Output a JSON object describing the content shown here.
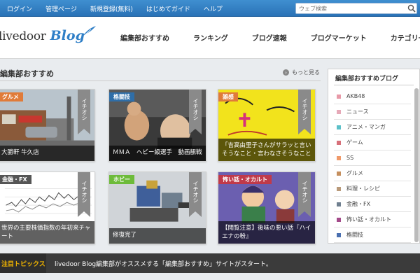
{
  "topbar": {
    "links": [
      "ログイン",
      "管理ページ",
      "新規登録(無料)",
      "はじめてガイド",
      "ヘルプ"
    ],
    "search_placeholder": "ウェブ検索"
  },
  "header": {
    "logo_text": "livedoor",
    "logo_blog": "Blog",
    "nav": [
      "編集部おすすめ",
      "ランキング",
      "ブログ速報",
      "ブログマーケット",
      "カテゴリ一覧"
    ]
  },
  "picks": {
    "title": "編集部おすすめ",
    "more": "もっと見る",
    "ribbon": "イチオシ",
    "cards": [
      {
        "tag": "グルメ",
        "tag_color": "#e07b39",
        "caption": "大勝軒 牛久店"
      },
      {
        "tag": "格闘技",
        "tag_color": "#2f6ea8",
        "caption": "ＭＭＡ　ヘビー級選手　動画観戦"
      },
      {
        "tag": "雑感",
        "tag_color": "#e07b39",
        "caption": "「吉高由里子さんがサラッと言いそうなこと・言わなさそうなこと"
      },
      {
        "tag": "金融・FX",
        "tag_color": "#555555",
        "caption": "世界の主要株価指数の年初来チャート"
      },
      {
        "tag": "ホビー",
        "tag_color": "#6dbb3a",
        "caption": "修復完了"
      },
      {
        "tag": "怖い話・オカルト",
        "tag_color": "#c03a4a",
        "caption": "【閲覧注意】後味の悪い話『ハイエナの粉』"
      }
    ]
  },
  "sidebar": {
    "title": "編集部おすすめブログ",
    "items": [
      {
        "label": "AKB48",
        "color": "#e89aa8"
      },
      {
        "label": "ニュース",
        "color": "#e6a9b8"
      },
      {
        "label": "アニメ・マンガ",
        "color": "#5cc0c8"
      },
      {
        "label": "ゲーム",
        "color": "#d7707a"
      },
      {
        "label": "SS",
        "color": "#f09a6a"
      },
      {
        "label": "グルメ",
        "color": "#c58f5e"
      },
      {
        "label": "料理・レシピ",
        "color": "#b99a7a"
      },
      {
        "label": "金融・FX",
        "color": "#6f7f8f"
      },
      {
        "label": "怖い話・オカルト",
        "color": "#a44a8a"
      },
      {
        "label": "格闘技",
        "color": "#4a6fb0"
      }
    ]
  },
  "topics": {
    "label": "注目トピックス",
    "text": "livedoor Blog編集部がオススメする「編集部おすすめ」サイトがスタート。"
  }
}
